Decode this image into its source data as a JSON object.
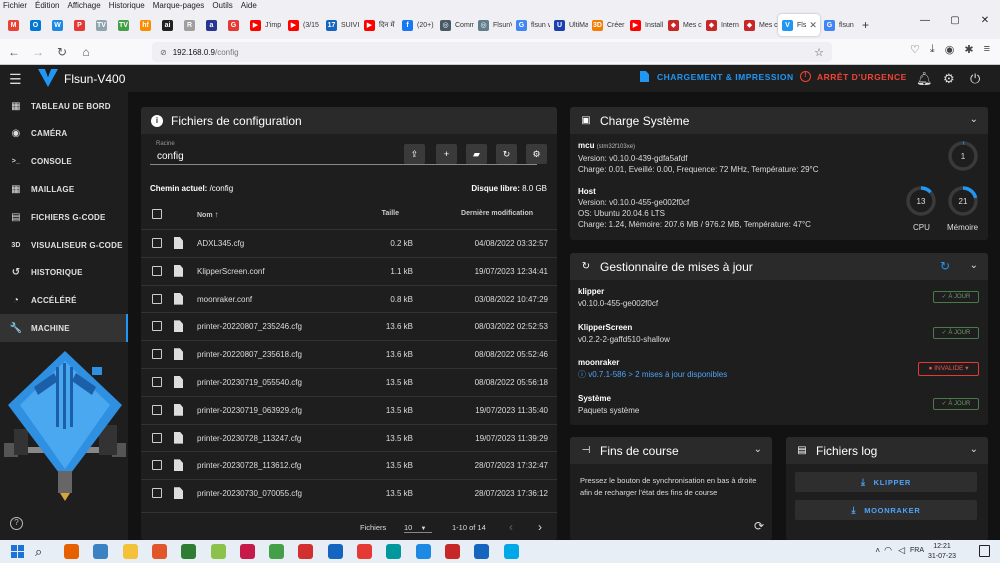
{
  "browser": {
    "menu": [
      "Fichier",
      "Édition",
      "Affichage",
      "Historique",
      "Marque-pages",
      "Outils",
      "Aide"
    ],
    "tabs": [
      {
        "label": "",
        "color": "#ea4335",
        "glyph": "M"
      },
      {
        "label": "",
        "color": "#0078d4",
        "glyph": "O"
      },
      {
        "label": "",
        "color": "#1e88e5",
        "glyph": "W"
      },
      {
        "label": "",
        "color": "#e53935",
        "glyph": "P"
      },
      {
        "label": "",
        "color": "#90a4ae",
        "glyph": "TV"
      },
      {
        "label": "",
        "color": "#43a047",
        "glyph": "TV"
      },
      {
        "label": "",
        "color": "#fb8c00",
        "glyph": "hf"
      },
      {
        "label": "",
        "color": "#212121",
        "glyph": "ai"
      },
      {
        "label": "",
        "color": "#9e9e9e",
        "glyph": "R"
      },
      {
        "label": "",
        "color": "#283593",
        "glyph": "a"
      },
      {
        "label": "",
        "color": "#e53935",
        "glyph": "G"
      },
      {
        "label": "J'imp",
        "color": "#ff0000",
        "glyph": "▶"
      },
      {
        "label": "(3/15",
        "color": "#ff0000",
        "glyph": "▶"
      },
      {
        "label": "SUIVI",
        "color": "#1565c0",
        "glyph": "17"
      },
      {
        "label": "दिन में",
        "color": "#ff0000",
        "glyph": "▶"
      },
      {
        "label": "(20+)",
        "color": "#1877f2",
        "glyph": "f"
      },
      {
        "label": "Comm",
        "color": "#455a64",
        "glyph": "◎"
      },
      {
        "label": "FlsunV400",
        "color": "#607d8b",
        "glyph": "◎"
      },
      {
        "label": "flsun v",
        "color": "#4285f4",
        "glyph": "G"
      },
      {
        "label": "UltiMa",
        "color": "#1e40af",
        "glyph": "U"
      },
      {
        "label": "Créer",
        "color": "#f57c00",
        "glyph": "3D"
      },
      {
        "label": "Install",
        "color": "#ff0000",
        "glyph": "▶"
      },
      {
        "label": "Mes c",
        "color": "#c62828",
        "glyph": "◆"
      },
      {
        "label": "Intern",
        "color": "#c62828",
        "glyph": "◆"
      },
      {
        "label": "Mes c",
        "color": "#c62828",
        "glyph": "◆"
      },
      {
        "label": "Fls",
        "color": "#2196f3",
        "glyph": "V",
        "active": true
      },
      {
        "label": "flsun",
        "color": "#4285f4",
        "glyph": "G"
      }
    ],
    "url_host": "192.168.0.9",
    "url_path": "/config"
  },
  "app": {
    "title": "Flsun-V400",
    "upload_label": "CHARGEMENT & IMPRESSION",
    "estop_label": "ARRÊT D'URGENCE"
  },
  "sidebar": {
    "items": [
      {
        "label": "TABLEAU DE BORD",
        "icon": "dashboard-icon",
        "glyph": "▦"
      },
      {
        "label": "CAMÉRA",
        "icon": "webcam-icon",
        "glyph": "◉"
      },
      {
        "label": "CONSOLE",
        "icon": "console-icon",
        "glyph": ">_"
      },
      {
        "label": "MAILLAGE",
        "icon": "grid-icon",
        "glyph": "▦"
      },
      {
        "label": "FICHIERS G-CODE",
        "icon": "files-icon",
        "glyph": "▤"
      },
      {
        "label": "VISUALISEUR G-CODE",
        "icon": "3d-icon",
        "glyph": "3D"
      },
      {
        "label": "HISTORIQUE",
        "icon": "history-icon",
        "glyph": "↺"
      },
      {
        "label": "ACCÉLÉRÉ",
        "icon": "timelapse-icon",
        "glyph": "◔"
      },
      {
        "label": "MACHINE",
        "icon": "wrench-icon",
        "glyph": "🔧",
        "active": true
      }
    ]
  },
  "files": {
    "title": "Fichiers de configuration",
    "root_label": "Racine",
    "root_value": "config",
    "current_dir_label": "Chemin actuel:",
    "current_dir": "/config",
    "free_disk_label": "Disque libre:",
    "free_disk": "8.0 GB",
    "headers": {
      "name": "Nom",
      "size": "Taille",
      "modified": "Dernière modification"
    },
    "rows": [
      {
        "name": "ADXL345.cfg",
        "size": "0.2 kB",
        "modified": "04/08/2022 03:32:57"
      },
      {
        "name": "KlipperScreen.conf",
        "size": "1.1 kB",
        "modified": "19/07/2023 12:34:41"
      },
      {
        "name": "moonraker.conf",
        "size": "0.8 kB",
        "modified": "03/08/2022 10:47:29"
      },
      {
        "name": "printer-20220807_235246.cfg",
        "size": "13.6 kB",
        "modified": "08/03/2022 02:52:53"
      },
      {
        "name": "printer-20220807_235618.cfg",
        "size": "13.6 kB",
        "modified": "08/08/2022 05:52:46"
      },
      {
        "name": "printer-20230719_055540.cfg",
        "size": "13.5 kB",
        "modified": "08/08/2022 05:56:18"
      },
      {
        "name": "printer-20230719_063929.cfg",
        "size": "13.5 kB",
        "modified": "19/07/2023 11:35:40"
      },
      {
        "name": "printer-20230728_113247.cfg",
        "size": "13.5 kB",
        "modified": "19/07/2023 11:39:29"
      },
      {
        "name": "printer-20230728_113612.cfg",
        "size": "13.5 kB",
        "modified": "28/07/2023 17:32:47"
      },
      {
        "name": "printer-20230730_070055.cfg",
        "size": "13.5 kB",
        "modified": "28/07/2023 17:36:12"
      }
    ],
    "pager": {
      "label": "Fichiers",
      "per_page": "10",
      "range": "1-10 of 14"
    }
  },
  "charge": {
    "title": "Charge Système",
    "mcu": {
      "name": "mcu",
      "chip": "(stm32f103xe)",
      "version": "Version: v0.10.0-439-gdfa5afdf",
      "stats": "Charge: 0.01, Eveillé: 0.00, Frequence: 72 MHz, Température: 29°C",
      "gauge": "1"
    },
    "host": {
      "name": "Host",
      "version": "Version: v0.10.0-455-ge002f0cf",
      "os": "OS: Ubuntu 20.04.6 LTS",
      "stats": "Charge: 1.24, Mémoire: 207.6 MB / 976.2 MB, Température: 47°C",
      "cpu_value": "13",
      "cpu_label": "CPU",
      "mem_value": "21",
      "mem_label": "Mémoire"
    }
  },
  "updates": {
    "title": "Gestionnaire de mises à jour",
    "items": [
      {
        "name": "klipper",
        "version": "v0.10.0-455-ge002f0cf",
        "status": "À JOUR"
      },
      {
        "name": "KlipperScreen",
        "version": "v0.2.2-2-gaffd510-shallow",
        "status": "À JOUR"
      },
      {
        "name": "moonraker",
        "version": "v0.7.1-586 > 2 mises à jour disponibles",
        "status": "INVALIDE"
      },
      {
        "name": "Système",
        "version": "Paquets système",
        "status": "À JOUR"
      }
    ]
  },
  "endstops": {
    "title": "Fins de course",
    "text": "Pressez le bouton de synchronisation en bas à droite afin de recharger l'état des fins de course"
  },
  "logs": {
    "title": "Fichiers log",
    "klipper": "KLIPPER",
    "moonraker": "MOONRAKER"
  },
  "taskbar": {
    "lang": "FRA",
    "time": "12:21",
    "date": "31-07-23"
  }
}
